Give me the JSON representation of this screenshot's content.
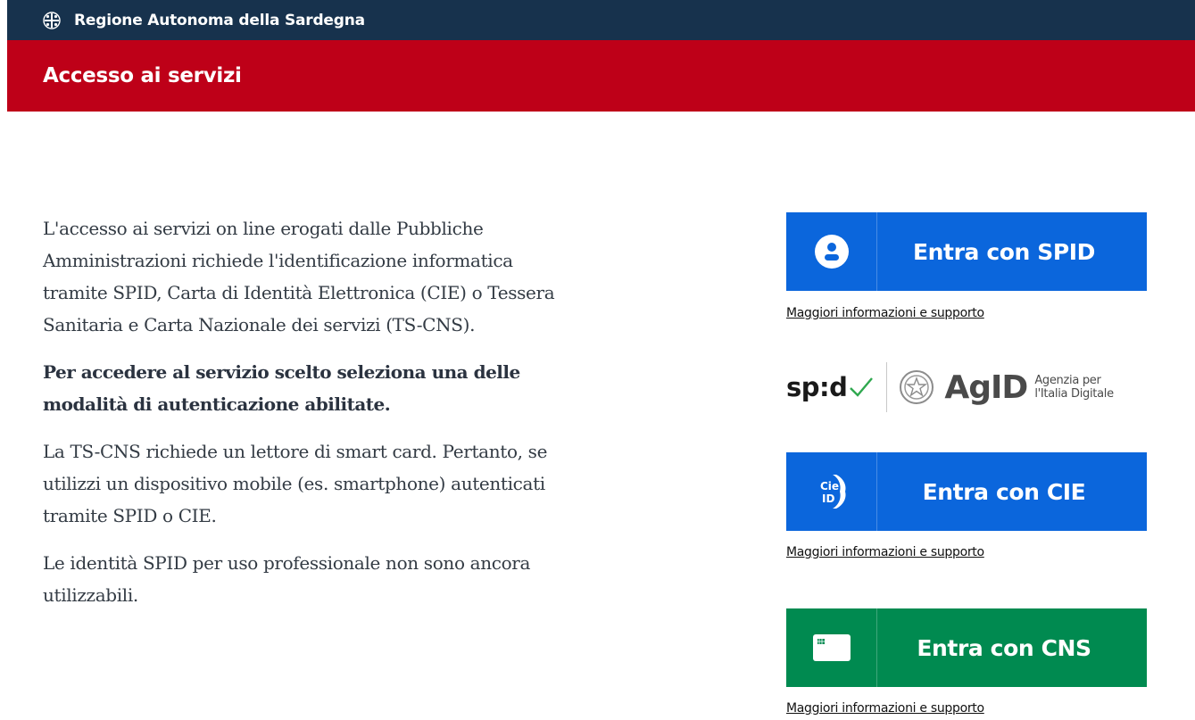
{
  "header": {
    "region_name": "Regione Autonoma della Sardegna",
    "page_title": "Accesso ai servizi"
  },
  "intro": {
    "paragraph_1": "L'accesso ai servizi on line erogati dalle Pubbliche Amministrazioni richiede l'identificazione informatica tramite SPID, Carta di Identità Elettronica (CIE) o Tessera Sanitaria e Carta Nazionale dei servizi (TS-CNS).",
    "paragraph_2": "Per accedere al servizio scelto seleziona una delle modalità di autenticazione abilitate.",
    "paragraph_3": "La TS-CNS richiede un lettore di smart card. Pertanto, se utilizzi un dispositivo mobile (es. smartphone) autenticati tramite SPID o CIE.",
    "paragraph_4": "Le identità SPID per uso professionale non sono ancora utilizzabili."
  },
  "login_options": {
    "spid": {
      "label": "Entra con SPID",
      "info_link": "Maggiori informazioni e supporto",
      "icon": "user-icon"
    },
    "cie": {
      "label": "Entra con CIE",
      "icon_text": "Cie ID",
      "info_link": "Maggiori informazioni e supporto",
      "icon": "cie-id-icon"
    },
    "cns": {
      "label": "Entra con CNS",
      "info_link": "Maggiori informazioni e supporto",
      "icon": "smart-card-icon"
    }
  },
  "logos": {
    "spid": "sp:d",
    "agid": "AgID",
    "agid_subtitle_line1": "Agenzia per",
    "agid_subtitle_line2": "l'Italia Digitale"
  },
  "colors": {
    "topbar": "#17324d",
    "title_bar": "#be0018",
    "button_blue": "#0b66dc",
    "button_green": "#008a50"
  }
}
